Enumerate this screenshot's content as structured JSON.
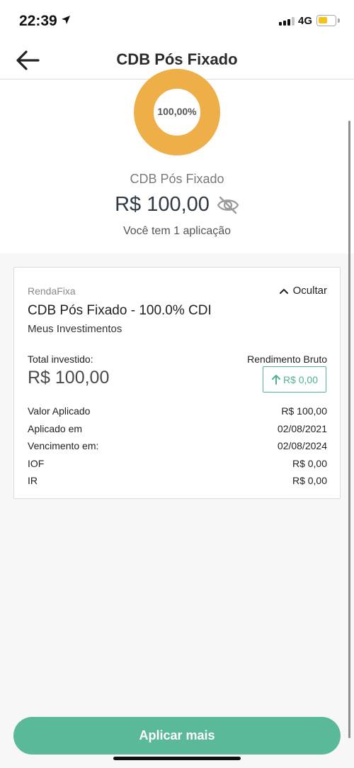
{
  "status_bar": {
    "time": "22:39",
    "network": "4G",
    "battery_level": 0.55,
    "battery_color": "#f0c419"
  },
  "header": {
    "title": "CDB Pós Fixado",
    "back_icon": "arrow-left-icon"
  },
  "summary": {
    "chart_percent_label": "100,00%",
    "chart_color": "#eeaf48",
    "asset_name": "CDB Pós Fixado",
    "total_amount": "R$ 100,00",
    "visibility_icon": "eye-off-icon",
    "applications_text": "Você tem 1 aplicação"
  },
  "card": {
    "category": "RendaFixa",
    "hide_label": "Ocultar",
    "hide_icon": "chevron-up-icon",
    "title": "CDB Pós Fixado - 100.0% CDI",
    "subtitle": "Meus Investimentos",
    "total_invested_label": "Total investido:",
    "total_invested_value": "R$ 100,00",
    "gross_yield_label": "Rendimento Bruto",
    "gross_yield_value": "R$ 0,00",
    "gross_yield_icon": "arrow-up-icon",
    "accent_color": "#4fb295",
    "details": [
      {
        "label": "Valor Aplicado",
        "value": "R$ 100,00"
      },
      {
        "label": "Aplicado em",
        "value": "02/08/2021"
      },
      {
        "label": "Vencimento em:",
        "value": "02/08/2024"
      },
      {
        "label": "IOF",
        "value": "R$ 0,00"
      },
      {
        "label": "IR",
        "value": "R$ 0,00"
      }
    ]
  },
  "footer": {
    "cta_label": "Aplicar mais",
    "cta_color": "#59b999"
  }
}
